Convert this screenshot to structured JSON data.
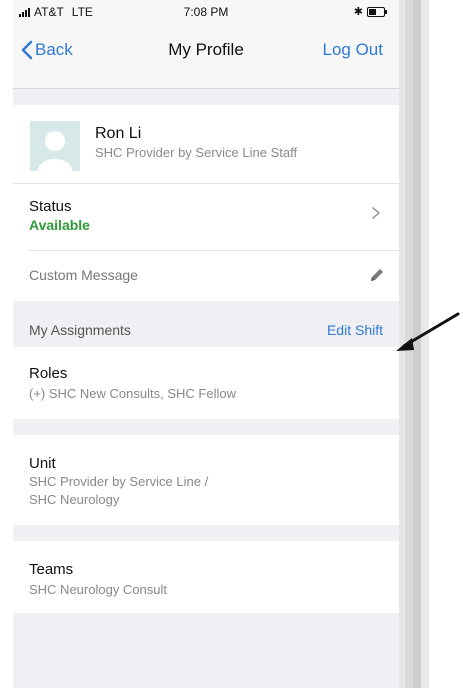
{
  "status_bar": {
    "carrier": "AT&T",
    "network": "LTE",
    "time": "7:08 PM"
  },
  "nav": {
    "back_label": "Back",
    "title": "My Profile",
    "logout_label": "Log Out"
  },
  "profile": {
    "name": "Ron Li",
    "subtitle": "SHC Provider by Service Line Staff"
  },
  "status": {
    "label": "Status",
    "value": "Available"
  },
  "custom_message": {
    "label": "Custom Message"
  },
  "assignments": {
    "title": "My Assignments",
    "action": "Edit Shift"
  },
  "roles": {
    "title": "Roles",
    "text": "(+) SHC New Consults, SHC Fellow"
  },
  "unit": {
    "title": "Unit",
    "line1": "SHC Provider by Service Line /",
    "line2": "SHC Neurology"
  },
  "teams": {
    "title": "Teams",
    "text": "SHC Neurology Consult"
  },
  "colors": {
    "accent": "#2f7ad6",
    "available": "#2e9b3a",
    "background": "#efeff4"
  }
}
